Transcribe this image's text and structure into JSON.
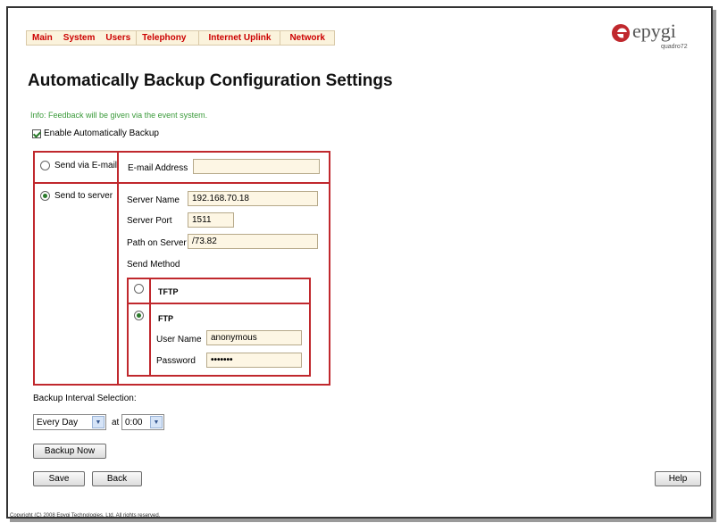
{
  "nav": {
    "items": [
      {
        "label": "Main"
      },
      {
        "label": "System"
      },
      {
        "label": "Users"
      },
      {
        "label": "Telephony"
      },
      {
        "label": "Internet Uplink"
      },
      {
        "label": "Network"
      }
    ]
  },
  "logo": {
    "text": "epygi",
    "sub": "quadro72"
  },
  "page": {
    "title": "Automatically Backup Configuration Settings",
    "info": "Info: Feedback will be given via the event system."
  },
  "enable": {
    "label": "Enable Automatically Backup",
    "checked": true
  },
  "email": {
    "option_label": "Send via E-mail",
    "address_label": "E-mail Address",
    "address_value": ""
  },
  "server": {
    "option_label": "Send to server",
    "name_label": "Server Name",
    "name_value": "192.168.70.18",
    "port_label": "Server Port",
    "port_value": "1511",
    "path_label": "Path on Server",
    "path_value": "/73.82",
    "method_label": "Send Method"
  },
  "method": {
    "tftp_label": "TFTP",
    "ftp_label": "FTP",
    "user_label": "User Name",
    "user_value": "anonymous",
    "password_label": "Password",
    "password_value": "•••••••"
  },
  "interval": {
    "label": "Backup Interval Selection:",
    "period": "Every Day",
    "at_label": "at",
    "time": "0:00"
  },
  "buttons": {
    "backup_now": "Backup Now",
    "save": "Save",
    "back": "Back",
    "help": "Help"
  },
  "footer": {
    "prefix": "Copyright (C) 2008 ",
    "company": "Epygi Technologies, Ltd.",
    "suffix": " All rights reserved."
  },
  "colors": {
    "accent_red": "#c0282d",
    "nav_text": "#cc0000",
    "info_green": "#3a9a3a"
  }
}
